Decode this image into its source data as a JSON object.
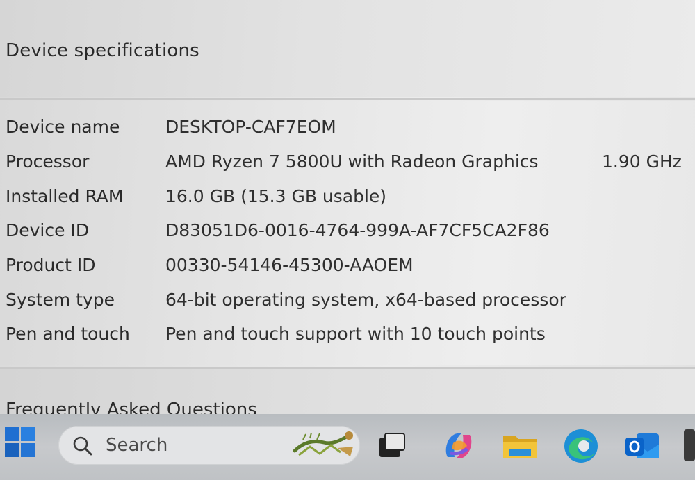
{
  "section": {
    "title": "Device specifications"
  },
  "specs": [
    {
      "label": "Device name",
      "value": "DESKTOP-CAF7EOM",
      "extra": ""
    },
    {
      "label": "Processor",
      "value": "AMD Ryzen 7 5800U with Radeon Graphics",
      "extra": "1.90 GHz"
    },
    {
      "label": "Installed RAM",
      "value": "16.0 GB (15.3 GB usable)",
      "extra": ""
    },
    {
      "label": "Device ID",
      "value": "D83051D6-0016-4764-999A-AF7CF5CA2F86",
      "extra": ""
    },
    {
      "label": "Product ID",
      "value": "00330-54146-45300-AAOEM",
      "extra": ""
    },
    {
      "label": "System type",
      "value": "64-bit operating system, x64-based processor",
      "extra": ""
    },
    {
      "label": "Pen and touch",
      "value": "Pen and touch support with 10 touch points",
      "extra": ""
    }
  ],
  "faq": {
    "title": "Frequently Asked Questions"
  },
  "taskbar": {
    "search_placeholder": "Search",
    "icons": [
      "windows-start-icon",
      "search-icon",
      "task-view-icon",
      "copilot-icon",
      "file-explorer-icon",
      "edge-icon",
      "outlook-icon"
    ]
  },
  "colors": {
    "start_blue": "#1f6fd1",
    "folder_yellow": "#f2c43a",
    "edge_blue": "#1d8fd6",
    "edge_green": "#39c27a",
    "outlook_blue": "#0a63c9"
  }
}
